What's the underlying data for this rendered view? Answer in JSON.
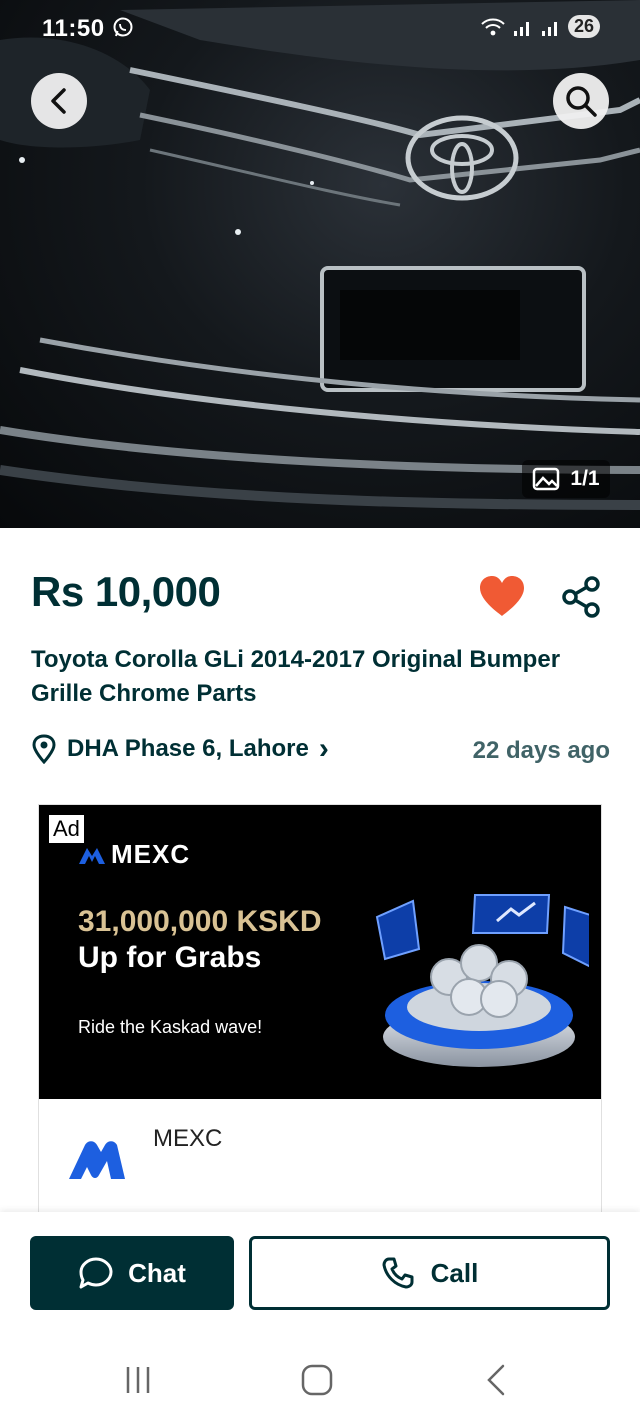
{
  "status_bar": {
    "time": "11:50",
    "battery": "26"
  },
  "gallery": {
    "counter": "1/1"
  },
  "listing": {
    "price": "Rs 10,000",
    "title": "Toyota Corolla GLi 2014-2017 Original Bumper Grille Chrome Parts",
    "location": "DHA Phase 6, Lahore",
    "location_chevron": "›",
    "posted": "22 days ago"
  },
  "ad": {
    "tag": "Ad",
    "brand": "MEXC",
    "headline": "31,000,000 KSKD",
    "subheadline": "Up for Grabs",
    "tagline": "Ride the Kaskad wave!",
    "footer_name": "MEXC"
  },
  "actions": {
    "chat_label": "Chat",
    "call_label": "Call"
  },
  "colors": {
    "primary": "#002f34",
    "heart": "#f05a34",
    "ad_gold": "#d9c294",
    "ad_blue": "#1d5fe0"
  },
  "icons": [
    "back-arrow-icon",
    "search-icon",
    "gallery-icon",
    "heart-icon",
    "share-icon",
    "location-pin-icon",
    "chat-bubble-icon",
    "phone-icon"
  ]
}
